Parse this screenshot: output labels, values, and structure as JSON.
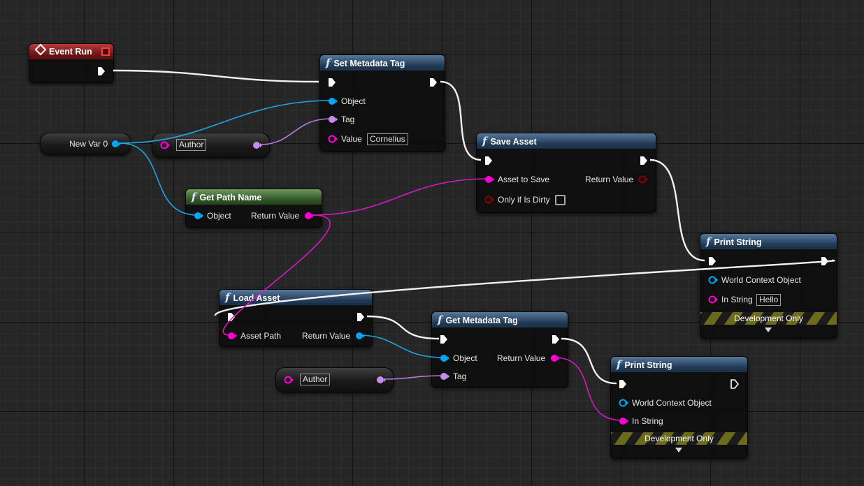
{
  "nodes": {
    "event_run": {
      "title": "Event Run"
    },
    "set_metadata_tag": {
      "title": "Set Metadata Tag",
      "pins": {
        "object": "Object",
        "tag": "Tag",
        "value": "Value"
      },
      "value_default": "Cornelius"
    },
    "save_asset": {
      "title": "Save Asset",
      "pins": {
        "asset_to_save": "Asset to Save",
        "only_if_dirty": "Only if Is Dirty",
        "return_value": "Return Value"
      }
    },
    "get_path_name": {
      "title": "Get Path Name",
      "pins": {
        "object": "Object",
        "return_value": "Return Value"
      }
    },
    "load_asset": {
      "title": "Load Asset",
      "pins": {
        "asset_path": "Asset Path",
        "return_value": "Return Value"
      }
    },
    "get_metadata_tag": {
      "title": "Get Metadata Tag",
      "pins": {
        "object": "Object",
        "tag": "Tag",
        "return_value": "Return Value"
      }
    },
    "print_string_1": {
      "title": "Print String",
      "pins": {
        "world_context": "World Context Object",
        "in_string": "In String"
      },
      "in_string_default": "Hello",
      "dev_only": "Development Only"
    },
    "print_string_2": {
      "title": "Print String",
      "pins": {
        "world_context": "World Context Object",
        "in_string": "In String"
      },
      "dev_only": "Development Only"
    }
  },
  "variables": {
    "new_var": "New Var 0",
    "author_1": "Author",
    "author_2": "Author"
  },
  "colors": {
    "exec_wire": "#ffffff",
    "object_pin": "#00a8f4",
    "string_pin": "#ff00d4",
    "name_pin": "#c88cf0",
    "bool_pin": "#8c0000",
    "function_header": "#2f4a68",
    "pure_header": "#3b6030",
    "event_header": "#8a1f1f"
  }
}
